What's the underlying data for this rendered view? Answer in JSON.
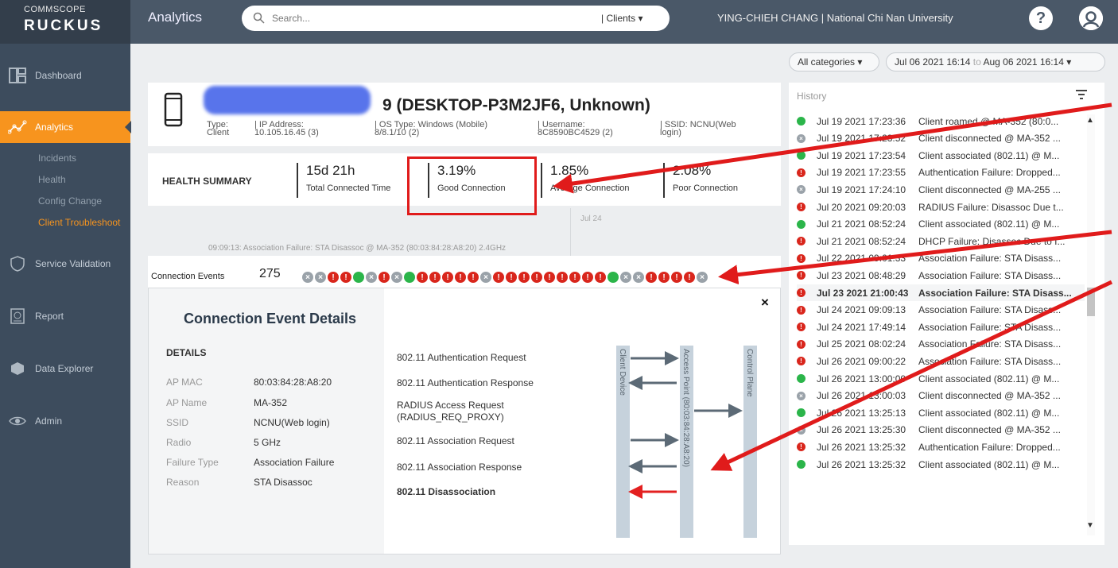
{
  "brand": {
    "line1": "COMMSCOPE",
    "line2": "RUCKUS"
  },
  "topbar": {
    "title": "Analytics",
    "search_placeholder": "Search...",
    "search_scope": "| Clients",
    "user": "YING-CHIEH CHANG | National Chi Nan University",
    "help": "?"
  },
  "sidebar": {
    "items": [
      {
        "label": "Dashboard",
        "icon": "dashboard-icon"
      },
      {
        "label": "Analytics",
        "icon": "analytics-icon"
      },
      {
        "label": "Service Validation",
        "icon": "shield-icon"
      },
      {
        "label": "Report",
        "icon": "report-icon"
      },
      {
        "label": "Data Explorer",
        "icon": "database-icon"
      },
      {
        "label": "Admin",
        "icon": "eye-icon"
      }
    ],
    "analytics_sub": [
      "Incidents",
      "Health",
      "Config Change",
      "Client Troubleshoot"
    ]
  },
  "filters": {
    "category": "All categories",
    "date_from": "Jul 06 2021 16:14",
    "date_to_word": "to",
    "date_to": "Aug 06 2021 16:14"
  },
  "client": {
    "name_suffix": "9 (DESKTOP-P3M2JF6, Unknown)",
    "meta": {
      "type": "Type:\nClient",
      "ip": "| IP Address:\n10.105.16.45 (3)",
      "os": "| OS Type: Windows (Mobile)\n8/8.1/10 (2)",
      "username": "| Username:\n8C8590BC4529 (2)",
      "ssid": "| SSID: NCNU(Web\nlogin)"
    }
  },
  "health_summary": {
    "label": "HEALTH SUMMARY",
    "stats": [
      {
        "value": "15d 21h",
        "label": "Total Connected Time"
      },
      {
        "value": "3.19%",
        "label": "Good Connection"
      },
      {
        "value": "1.85%",
        "label": "Average Connection"
      },
      {
        "value": "2.08%",
        "label": "Poor Connection"
      }
    ]
  },
  "timeline": {
    "marker": "Jul 24",
    "failure_note": "09:09:13: Association Failure: STA Disassoc @ MA-352 (80:03:84:28:A8:20) 2.4GHz",
    "events_label": "Connection Events",
    "events_count": "275",
    "dots": [
      "x",
      "x",
      "r",
      "r",
      "g",
      "x",
      "r",
      "x",
      "g",
      "r",
      "r",
      "r",
      "r",
      "r",
      "x",
      "r",
      "r",
      "r",
      "r",
      "r",
      "r",
      "r",
      "r",
      "r",
      "g",
      "x",
      "x",
      "r",
      "r",
      "r",
      "r",
      "x"
    ]
  },
  "event_details": {
    "title": "Connection Event Details",
    "details_label": "DETAILS",
    "fields": [
      {
        "key": "AP MAC",
        "value": "80:03:84:28:A8:20"
      },
      {
        "key": "AP Name",
        "value": "MA-352"
      },
      {
        "key": "SSID",
        "value": "NCNU(Web login)"
      },
      {
        "key": "Radio",
        "value": "5 GHz"
      },
      {
        "key": "Failure Type",
        "value": "Association Failure"
      },
      {
        "key": "Reason",
        "value": "STA Disassoc"
      }
    ],
    "messages": [
      "802.11 Authentication Request",
      "802.11 Authentication Response",
      "RADIUS Access Request (RADIUS_REQ_PROXY)",
      "802.11 Association Request",
      "802.11 Association Response",
      "802.11 Disassociation"
    ],
    "lanes": [
      "Client Device",
      "Access Point (80:03:84:28:A8:20)",
      "Control Plane"
    ],
    "close": "×"
  },
  "history": {
    "title": "History",
    "rows": [
      {
        "status": "success",
        "time": "Jul 19 2021 17:23:36",
        "msg": "Client roamed @ MA-352 (80:0..."
      },
      {
        "status": "neutral",
        "time": "Jul 19 2021 17:23:52",
        "msg": "Client disconnected @ MA-352 ..."
      },
      {
        "status": "success",
        "time": "Jul 19 2021 17:23:54",
        "msg": "Client associated (802.11) @ M..."
      },
      {
        "status": "failure",
        "time": "Jul 19 2021 17:23:55",
        "msg": "Authentication Failure: Dropped..."
      },
      {
        "status": "neutral",
        "time": "Jul 19 2021 17:24:10",
        "msg": "Client disconnected @ MA-255 ..."
      },
      {
        "status": "failure",
        "time": "Jul 20 2021 09:20:03",
        "msg": "RADIUS Failure: Disassoc Due t..."
      },
      {
        "status": "success",
        "time": "Jul 21 2021 08:52:24",
        "msg": "Client associated (802.11) @ M..."
      },
      {
        "status": "failure",
        "time": "Jul 21 2021 08:52:24",
        "msg": "DHCP Failure: Disassoc Due to I..."
      },
      {
        "status": "failure",
        "time": "Jul 22 2021 09:01:33",
        "msg": "Association Failure: STA Disass..."
      },
      {
        "status": "failure",
        "time": "Jul 23 2021 08:48:29",
        "msg": "Association Failure: STA Disass..."
      },
      {
        "status": "failure",
        "time": "Jul 23 2021 21:00:43",
        "msg": "Association Failure: STA Disass...",
        "selected": true
      },
      {
        "status": "failure",
        "time": "Jul 24 2021 09:09:13",
        "msg": "Association Failure: STA Disass..."
      },
      {
        "status": "failure",
        "time": "Jul 24 2021 17:49:14",
        "msg": "Association Failure: STA Disass..."
      },
      {
        "status": "failure",
        "time": "Jul 25 2021 08:02:24",
        "msg": "Association Failure: STA Disass..."
      },
      {
        "status": "failure",
        "time": "Jul 26 2021 09:00:22",
        "msg": "Association Failure: STA Disass..."
      },
      {
        "status": "success",
        "time": "Jul 26 2021 13:00:00",
        "msg": "Client associated (802.11) @ M..."
      },
      {
        "status": "neutral",
        "time": "Jul 26 2021 13:00:03",
        "msg": "Client disconnected @ MA-352 ..."
      },
      {
        "status": "success",
        "time": "Jul 26 2021 13:25:13",
        "msg": "Client associated (802.11) @ M..."
      },
      {
        "status": "neutral",
        "time": "Jul 26 2021 13:25:30",
        "msg": "Client disconnected @ MA-352 ..."
      },
      {
        "status": "failure",
        "time": "Jul 26 2021 13:25:32",
        "msg": "Authentication Failure: Dropped..."
      },
      {
        "status": "success",
        "time": "Jul 26 2021 13:25:32",
        "msg": "Client associated (802.11) @ M..."
      }
    ]
  },
  "colors": {
    "accent": "#f7941e",
    "sidebar": "#3d4c5d",
    "topbar": "#4a5868",
    "success": "#2bb54a",
    "failure": "#d9261c",
    "neutral": "#9aa2a9",
    "annotation": "#e01b1b"
  }
}
